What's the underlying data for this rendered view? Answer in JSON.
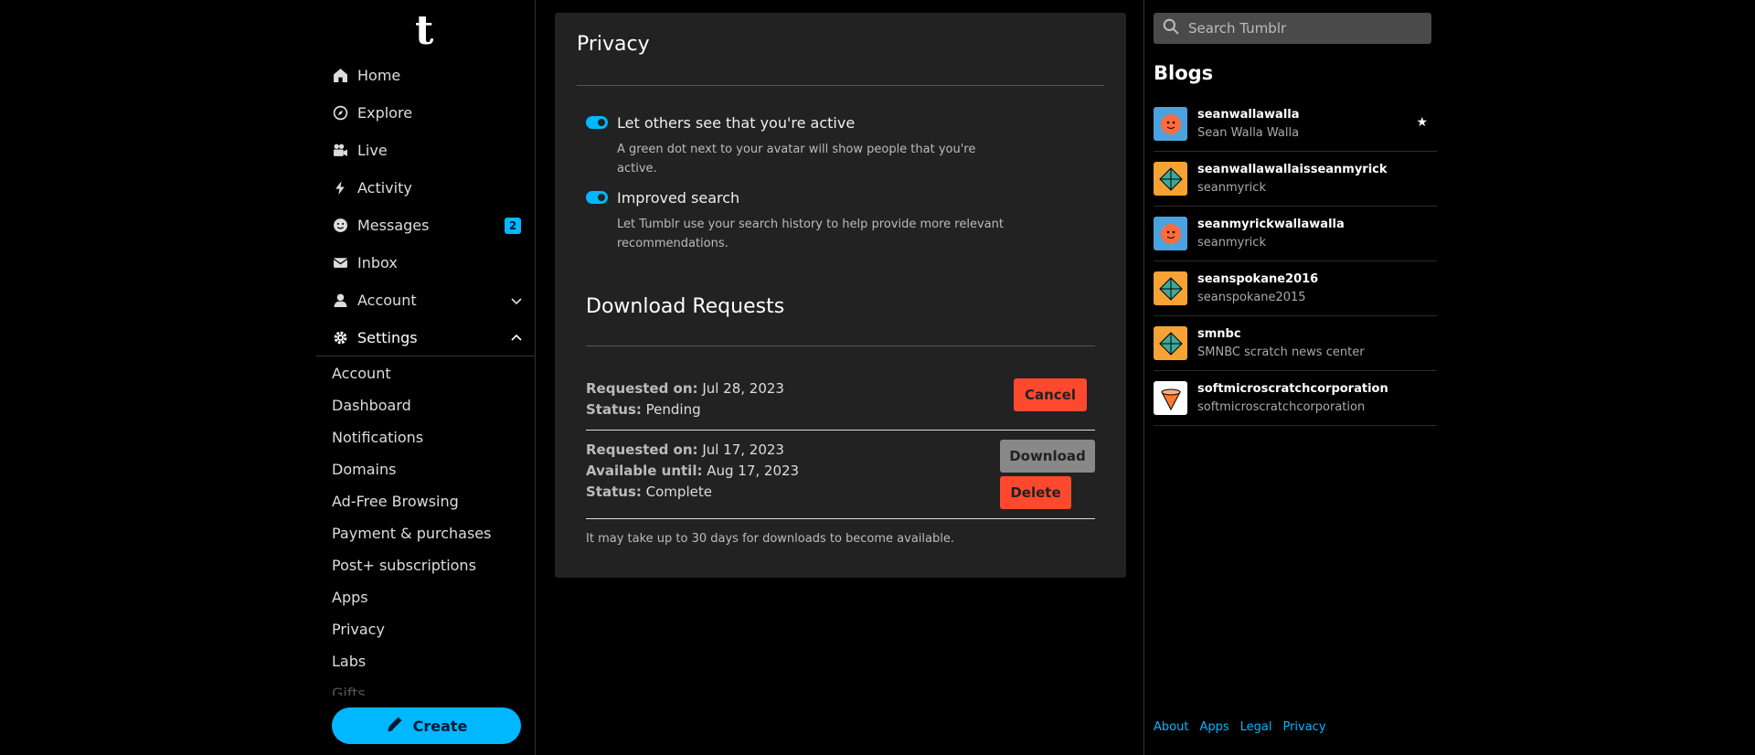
{
  "sidebar": {
    "logo": "t",
    "nav": [
      {
        "label": "Home",
        "icon": "home-icon"
      },
      {
        "label": "Explore",
        "icon": "compass-icon"
      },
      {
        "label": "Live",
        "icon": "camera-icon"
      },
      {
        "label": "Activity",
        "icon": "bolt-icon"
      },
      {
        "label": "Messages",
        "icon": "smile-icon",
        "badge": "2"
      },
      {
        "label": "Inbox",
        "icon": "mail-icon"
      },
      {
        "label": "Account",
        "icon": "person-icon"
      },
      {
        "label": "Settings",
        "icon": "gear-icon"
      }
    ],
    "settings_items": [
      "Account",
      "Dashboard",
      "Notifications",
      "Domains",
      "Ad-Free Browsing",
      "Payment & purchases",
      "Post+ subscriptions",
      "Apps",
      "Privacy",
      "Labs",
      "Gifts"
    ],
    "create_label": "Create"
  },
  "main": {
    "title": "Privacy",
    "options": [
      {
        "title": "Let others see that you're active",
        "desc": "A green dot next to your avatar will show people that you're active.",
        "enabled": true
      },
      {
        "title": "Improved search",
        "desc": "Let Tumblr use your search history to help provide more relevant recommendations.",
        "enabled": true
      }
    ],
    "downloads_title": "Download Requests",
    "requests": [
      {
        "requested_label": "Requested on:",
        "requested": "Jul 28, 2023",
        "status_label": "Status:",
        "status": "Pending",
        "cancel_label": "Cancel"
      },
      {
        "requested_label": "Requested on:",
        "requested": "Jul 17, 2023",
        "available_label": "Available until:",
        "available": "Aug 17, 2023",
        "status_label": "Status:",
        "status": "Complete",
        "download_label": "Download",
        "delete_label": "Delete"
      }
    ],
    "note": "It may take up to 30 days for downloads to become available."
  },
  "right": {
    "search_placeholder": "Search Tumblr",
    "blogs_title": "Blogs",
    "blogs": [
      {
        "name": "seanwallawalla",
        "title": "Sean Walla Walla",
        "avatar": "face",
        "color": "#4aa3df",
        "primary": true
      },
      {
        "name": "seanwallawallaisseanmyrick",
        "title": "seanmyrick",
        "avatar": "diamond",
        "color": "#f7a234"
      },
      {
        "name": "seanmyrickwallawalla",
        "title": "seanmyrick",
        "avatar": "face",
        "color": "#4aa3df"
      },
      {
        "name": "seanspokane2016",
        "title": "seanspokane2015",
        "avatar": "diamond",
        "color": "#f7a234"
      },
      {
        "name": "smnbc",
        "title": "SMNBC scratch news center",
        "avatar": "diamond",
        "color": "#f7a234"
      },
      {
        "name": "softmicroscratchcorporation",
        "title": "softmicroscratchcorporation",
        "avatar": "cone",
        "color": "#ffffff"
      }
    ],
    "footer": [
      "About",
      "Apps",
      "Legal",
      "Privacy"
    ]
  }
}
